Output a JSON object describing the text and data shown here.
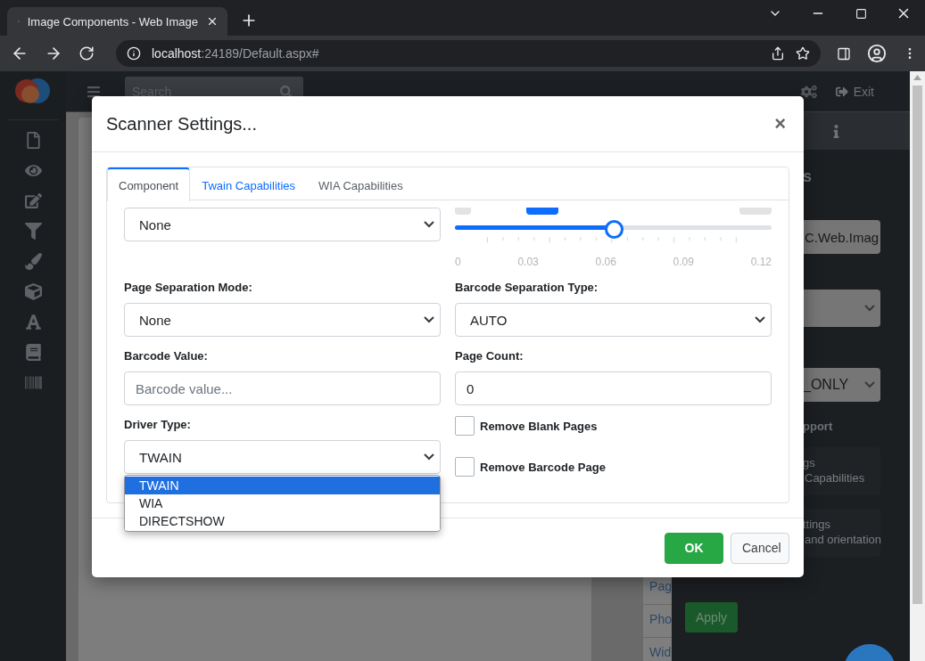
{
  "browser": {
    "tab_title": "Image Components - Web Image",
    "url_host": "localhost",
    "url_path": ":24189/Default.aspx#"
  },
  "header": {
    "search_placeholder": "Search",
    "exit": "Exit"
  },
  "right_panel": {
    "heading": "s",
    "field_value": "C.Web.Imag",
    "select_value": "_ONLY",
    "section_title": "pport",
    "cards": [
      {
        "lines": [
          "gs",
          "Capabilities"
        ]
      },
      {
        "lines": [
          "ttings",
          "and orientation"
        ]
      }
    ],
    "apply": "Apply"
  },
  "list_items": [
    "Pag",
    "Pho",
    "Wid"
  ],
  "modal": {
    "title": "Scanner Settings...",
    "close": "×",
    "tabs": [
      {
        "label": "Component",
        "selected": true,
        "hovered": false
      },
      {
        "label": "Twain Capabilities",
        "selected": false,
        "hovered": true
      },
      {
        "label": "WIA Capabilities",
        "selected": false,
        "hovered": false
      }
    ],
    "rows": [
      {
        "cells": [
          {
            "kind": "select",
            "value": "None"
          },
          {
            "kind": "slider",
            "level": 0.5,
            "ticks": [
              "0",
              "0.03",
              "0.06",
              "0.09",
              "0.12"
            ]
          }
        ]
      },
      {
        "cells": [
          {
            "kind": "select",
            "label": "Page Separation Mode:",
            "value": "None"
          },
          {
            "kind": "select",
            "label": "Barcode Separation Type:",
            "value": "AUTO"
          }
        ]
      },
      {
        "cells": [
          {
            "kind": "input",
            "label": "Barcode Value:",
            "placeholder": "Barcode value..."
          },
          {
            "kind": "input",
            "label": "Page Count:",
            "value": "0"
          }
        ]
      },
      {
        "cells": [
          {
            "kind": "select",
            "label": "Driver Type:",
            "value": "TWAIN",
            "open": true,
            "options": [
              {
                "label": "TWAIN",
                "selected": true
              },
              {
                "label": "WIA",
                "selected": false
              },
              {
                "label": "DIRECTSHOW",
                "selected": false
              }
            ]
          },
          {
            "kind": "checks",
            "items": [
              {
                "label": "Remove Blank Pages",
                "checked": false
              },
              {
                "label": "Remove Barcode Page",
                "checked": false
              }
            ]
          }
        ]
      }
    ],
    "buttons": [
      {
        "label": "OK",
        "kind": "primary"
      },
      {
        "label": "Cancel",
        "kind": "secondary"
      }
    ]
  }
}
